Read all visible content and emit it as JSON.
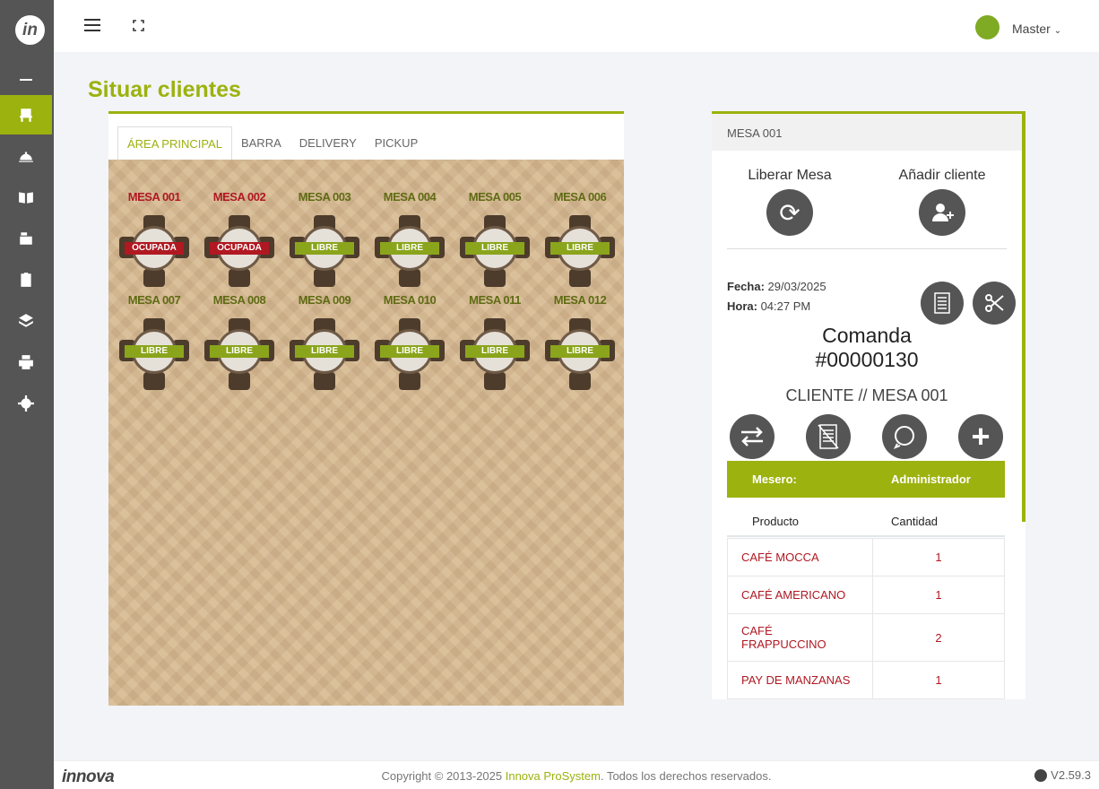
{
  "header": {
    "user": "Master"
  },
  "page_title": "Situar clientes",
  "tabs": [
    {
      "label": "ÁREA PRINCIPAL"
    },
    {
      "label": "BARRA"
    },
    {
      "label": "DELIVERY"
    },
    {
      "label": "PICKUP"
    }
  ],
  "mesas": [
    {
      "name": "MESA 001",
      "status": "OCUPADA"
    },
    {
      "name": "MESA 002",
      "status": "OCUPADA"
    },
    {
      "name": "MESA 003",
      "status": "LIBRE"
    },
    {
      "name": "MESA 004",
      "status": "LIBRE"
    },
    {
      "name": "MESA 005",
      "status": "LIBRE"
    },
    {
      "name": "MESA 006",
      "status": "LIBRE"
    },
    {
      "name": "MESA 007",
      "status": "LIBRE"
    },
    {
      "name": "MESA 008",
      "status": "LIBRE"
    },
    {
      "name": "MESA 009",
      "status": "LIBRE"
    },
    {
      "name": "MESA 010",
      "status": "LIBRE"
    },
    {
      "name": "MESA 011",
      "status": "LIBRE"
    },
    {
      "name": "MESA 012",
      "status": "LIBRE"
    }
  ],
  "detail": {
    "title": "MESA 001",
    "liberar": "Liberar Mesa",
    "anadir": "Añadir cliente",
    "fecha_label": "Fecha:",
    "fecha": "29/03/2025",
    "hora_label": "Hora:",
    "hora": "04:27 PM",
    "comanda": "Comanda",
    "comanda_num": "#00000130",
    "cliente": "CLIENTE // MESA 001",
    "mesero_label": "Mesero:",
    "mesero": "Administrador",
    "col_producto": "Producto",
    "col_cantidad": "Cantidad",
    "items": [
      {
        "producto": "CAFÉ MOCCA",
        "cantidad": "1"
      },
      {
        "producto": "CAFÉ AMERICANO",
        "cantidad": "1"
      },
      {
        "producto": "CAFÉ FRAPPUCCINO",
        "cantidad": "2"
      },
      {
        "producto": "PAY DE MANZANAS",
        "cantidad": "1"
      }
    ]
  },
  "footer": {
    "brand": "innova",
    "copy_pre": "Copyright © 2013-2025 ",
    "copy_brand": "Innova ProSystem",
    "copy_post": ". Todos los derechos reservados.",
    "version": "V2.59.3"
  },
  "colors": {
    "accent": "#9cb20e",
    "busy": "#b01822",
    "sidebar": "#555555"
  }
}
